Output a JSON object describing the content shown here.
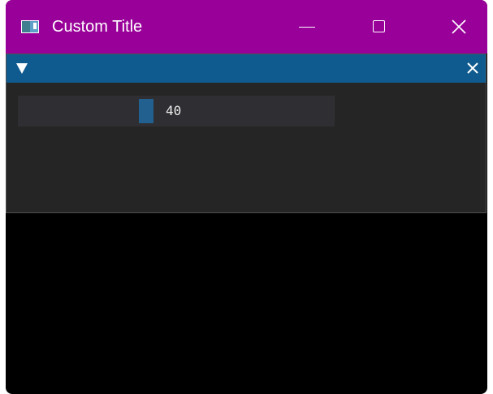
{
  "window": {
    "title": "Custom Title",
    "icon": "app-window-icon",
    "titlebar_color": "#990099"
  },
  "controls": {
    "minimize_icon": "minimize-icon",
    "maximize_icon": "maximize-icon",
    "close_icon": "close-icon"
  },
  "imgui_window": {
    "header_color": "#0f5b8f",
    "collapse_icon": "collapse-arrow-icon",
    "close_icon": "close-icon",
    "slider": {
      "value": "40",
      "grab_color": "#22618f"
    }
  }
}
